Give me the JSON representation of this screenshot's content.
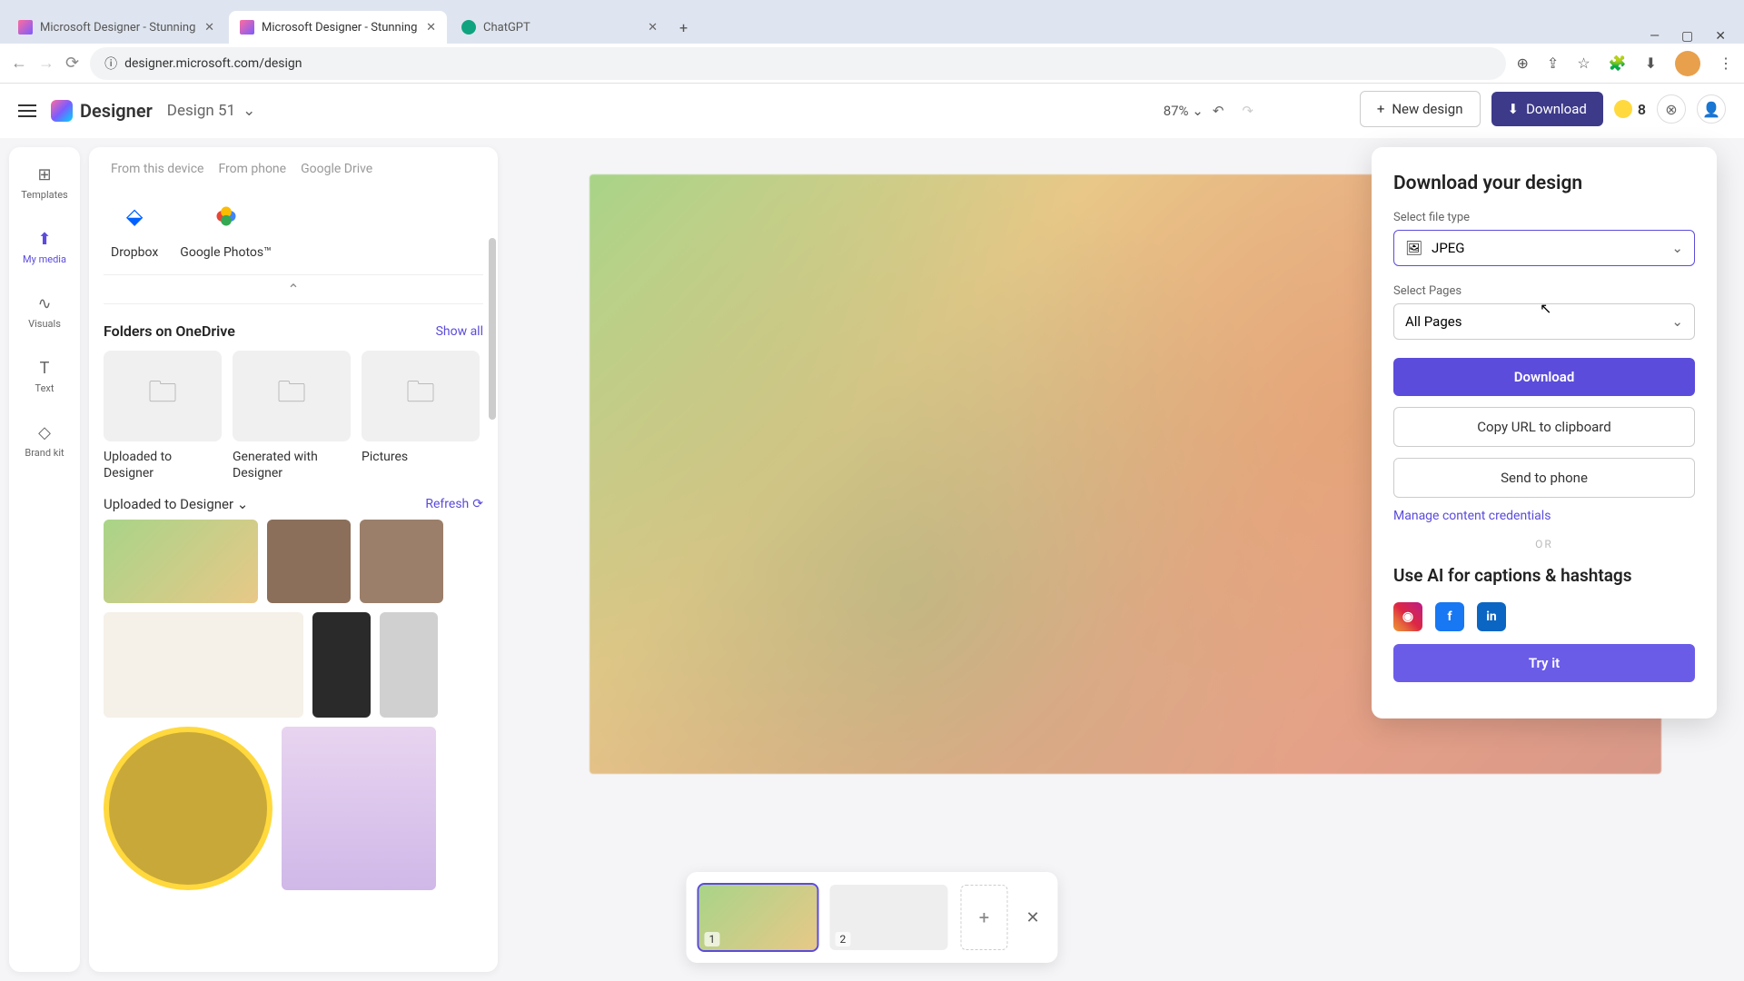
{
  "browser": {
    "tabs": [
      {
        "title": "Microsoft Designer - Stunning",
        "active": false
      },
      {
        "title": "Microsoft Designer - Stunning",
        "active": true
      },
      {
        "title": "ChatGPT",
        "active": false
      }
    ],
    "url": "designer.microsoft.com/design"
  },
  "header": {
    "app_name": "Designer",
    "design_name": "Design 51",
    "zoom": "87%",
    "new_design": "New design",
    "download": "Download",
    "credits": "8"
  },
  "toolbar": {
    "items": [
      {
        "label": "Templates",
        "icon": "⊞"
      },
      {
        "label": "My media",
        "icon": "⬆"
      },
      {
        "label": "Visuals",
        "icon": "∿"
      },
      {
        "label": "Text",
        "icon": "T"
      },
      {
        "label": "Brand kit",
        "icon": "◇"
      }
    ]
  },
  "media_panel": {
    "sources_tabs": [
      "From this device",
      "From phone",
      "Google Drive"
    ],
    "cloud_sources": [
      {
        "label": "Dropbox"
      },
      {
        "label": "Google Photos™"
      }
    ],
    "folders_heading": "Folders on OneDrive",
    "show_all": "Show all",
    "folders": [
      {
        "label": "Uploaded to Designer"
      },
      {
        "label": "Generated with Designer"
      },
      {
        "label": "Pictures"
      }
    ],
    "uploaded_heading": "Uploaded to Designer",
    "refresh": "Refresh"
  },
  "download_panel": {
    "title": "Download your design",
    "file_type_label": "Select file type",
    "file_type_value": "JPEG",
    "pages_label": "Select Pages",
    "pages_value": "All Pages",
    "download_btn": "Download",
    "copy_btn": "Copy URL to clipboard",
    "send_btn": "Send to phone",
    "credentials_link": "Manage content credentials",
    "or": "OR",
    "ai_heading": "Use AI for captions & hashtags",
    "try_it": "Try it"
  },
  "filmstrip": {
    "pages": [
      "1",
      "2"
    ]
  }
}
